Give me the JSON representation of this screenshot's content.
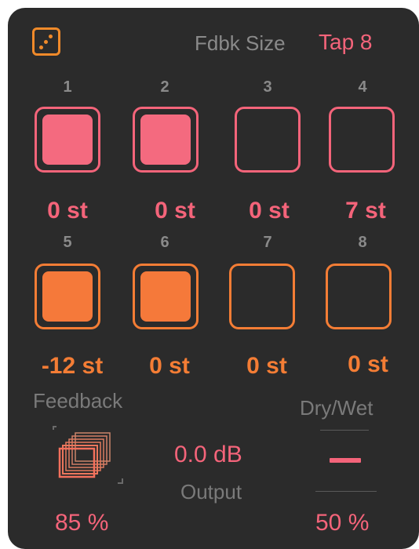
{
  "header": {
    "dice_icon": "dice-icon",
    "fdbk_label": "Fdbk Size",
    "tap_value": "Tap 8"
  },
  "taps_row1": [
    {
      "number": "1",
      "active": true,
      "semitones": "0 st"
    },
    {
      "number": "2",
      "active": true,
      "semitones": "0 st"
    },
    {
      "number": "3",
      "active": false,
      "semitones": "0 st"
    },
    {
      "number": "4",
      "active": false,
      "semitones": "7 st"
    }
  ],
  "taps_row2": [
    {
      "number": "5",
      "active": true,
      "semitones": "-12 st"
    },
    {
      "number": "6",
      "active": true,
      "semitones": "0 st"
    },
    {
      "number": "7",
      "active": false,
      "semitones": "0 st"
    },
    {
      "number": "8",
      "active": false,
      "semitones": "0 st"
    }
  ],
  "colors": {
    "pink": "#f4647a",
    "pink_fill": "#f46a7f",
    "orange": "#f47d35",
    "orange_fill": "#f5793a",
    "label_gray": "#8a8a8a",
    "panel": "#2b2b2b"
  },
  "feedback": {
    "label": "Feedback",
    "value": "85 %",
    "icon": "stacked-squares-icon"
  },
  "output": {
    "value": "0.0 dB",
    "label": "Output"
  },
  "drywet": {
    "label": "Dry/Wet",
    "value": "50 %",
    "level": 0.5
  }
}
